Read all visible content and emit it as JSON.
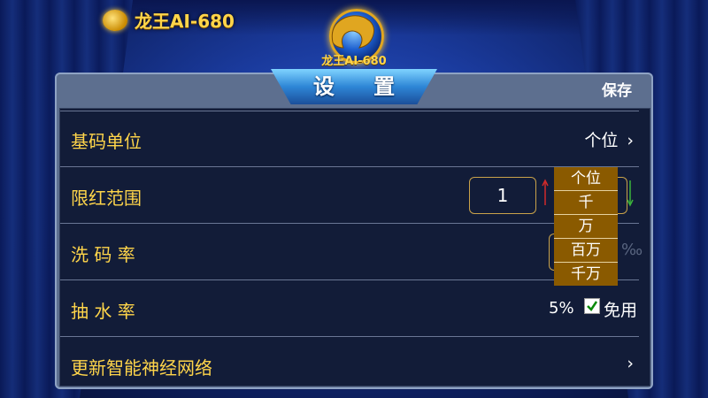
{
  "brand": {
    "name": "龙王AI-680"
  },
  "logo": {
    "text": "龙王AI-680"
  },
  "panel": {
    "title": "设 置",
    "save_label": "保存"
  },
  "rows": [
    {
      "label": "基码单位",
      "value": "个位",
      "chevron": "›"
    },
    {
      "label": "限红范围",
      "min_value": "1"
    },
    {
      "label": "洗 码 率",
      "unit": "‰"
    },
    {
      "label": "抽 水 率",
      "rate": "5%",
      "checkbox_checked": true,
      "checkbox_label": "免用"
    },
    {
      "label": "更新智能神经网络",
      "chevron": "›"
    }
  ],
  "dropdown": {
    "options": [
      "个位",
      "千",
      "万",
      "百万",
      "千万"
    ]
  },
  "colors": {
    "accent": "#ffd54a",
    "dropdown_bg": "#8a5a00",
    "panel_bg": "#121c38"
  }
}
